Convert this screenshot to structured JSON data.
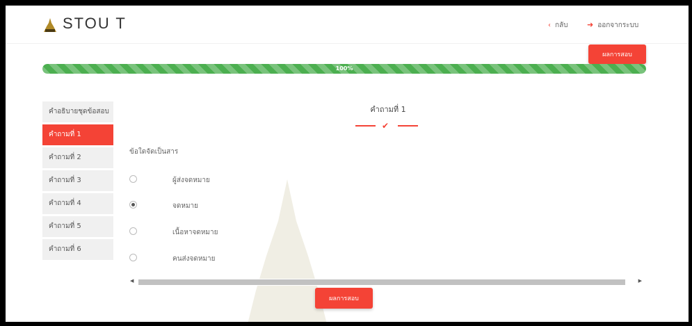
{
  "header": {
    "brand": "STOU T",
    "back_label": "กลับ",
    "logout_label": "ออกจากระบบ"
  },
  "result_button_label": "ผลการสอบ",
  "progress": {
    "value": 1.0,
    "label": "100%"
  },
  "sidebar": {
    "items": [
      {
        "label": "คำอธิบายชุดข้อสอบ"
      },
      {
        "label": "คำถามที่ 1"
      },
      {
        "label": "คำถามที่ 2"
      },
      {
        "label": "คำถามที่ 3"
      },
      {
        "label": "คำถามที่ 4"
      },
      {
        "label": "คำถามที่ 5"
      },
      {
        "label": "คำถามที่ 6"
      }
    ],
    "active_index": 1
  },
  "question": {
    "title": "คำถามที่ 1",
    "text": "ข้อใดจัดเป็นสาร",
    "options": [
      {
        "label": "ผู้ส่งจดหมาย",
        "checked": false
      },
      {
        "label": "จดหมาย",
        "checked": true
      },
      {
        "label": "เนื้อหาจดหมาย",
        "checked": false
      },
      {
        "label": "คนส่งจดหมาย",
        "checked": false
      }
    ]
  },
  "colors": {
    "accent": "#f44336",
    "progress": "#4caf50"
  }
}
